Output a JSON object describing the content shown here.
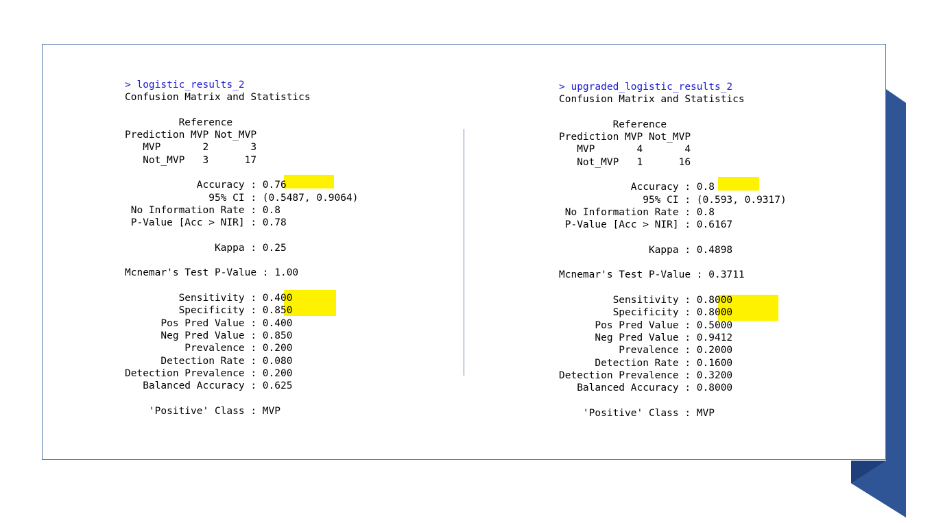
{
  "panels": [
    {
      "command": "> logistic_results_2",
      "title": "Confusion Matrix and Statistics",
      "matrix": [
        "         Reference",
        "Prediction MVP Not_MVP",
        "   MVP       2       3",
        "   Not_MVP   3      17"
      ],
      "stats": [
        "            Accuracy : 0.76",
        "              95% CI : (0.5487, 0.9064)",
        " No Information Rate : 0.8",
        " P-Value [Acc > NIR] : 0.78",
        "",
        "               Kappa : 0.25",
        "",
        "Mcnemar's Test P-Value : 1.00",
        "",
        "         Sensitivity : 0.400",
        "         Specificity : 0.850",
        "      Pos Pred Value : 0.400",
        "      Neg Pred Value : 0.850",
        "          Prevalence : 0.200",
        "      Detection Rate : 0.080",
        "Detection Prevalence : 0.200",
        "   Balanced Accuracy : 0.625",
        "",
        "    'Positive' Class : MVP"
      ]
    },
    {
      "command": "> upgraded_logistic_results_2",
      "title": "Confusion Matrix and Statistics",
      "matrix": [
        "         Reference",
        "Prediction MVP Not_MVP",
        "   MVP       4       4",
        "   Not_MVP   1      16"
      ],
      "stats": [
        "            Accuracy : 0.8",
        "              95% CI : (0.593, 0.9317)",
        " No Information Rate : 0.8",
        " P-Value [Acc > NIR] : 0.6167",
        "",
        "               Kappa : 0.4898",
        "",
        "Mcnemar's Test P-Value : 0.3711",
        "",
        "         Sensitivity : 0.8000",
        "         Specificity : 0.8000",
        "      Pos Pred Value : 0.5000",
        "      Neg Pred Value : 0.9412",
        "          Prevalence : 0.2000",
        "      Detection Rate : 0.1600",
        "Detection Prevalence : 0.3200",
        "   Balanced Accuracy : 0.8000",
        "",
        "    'Positive' Class : MVP"
      ]
    }
  ],
  "colors": {
    "highlight": "#fff200",
    "command": "#1a1ad6",
    "frame_border": "#4a6fa5",
    "accent_shape": "#2f5597"
  }
}
